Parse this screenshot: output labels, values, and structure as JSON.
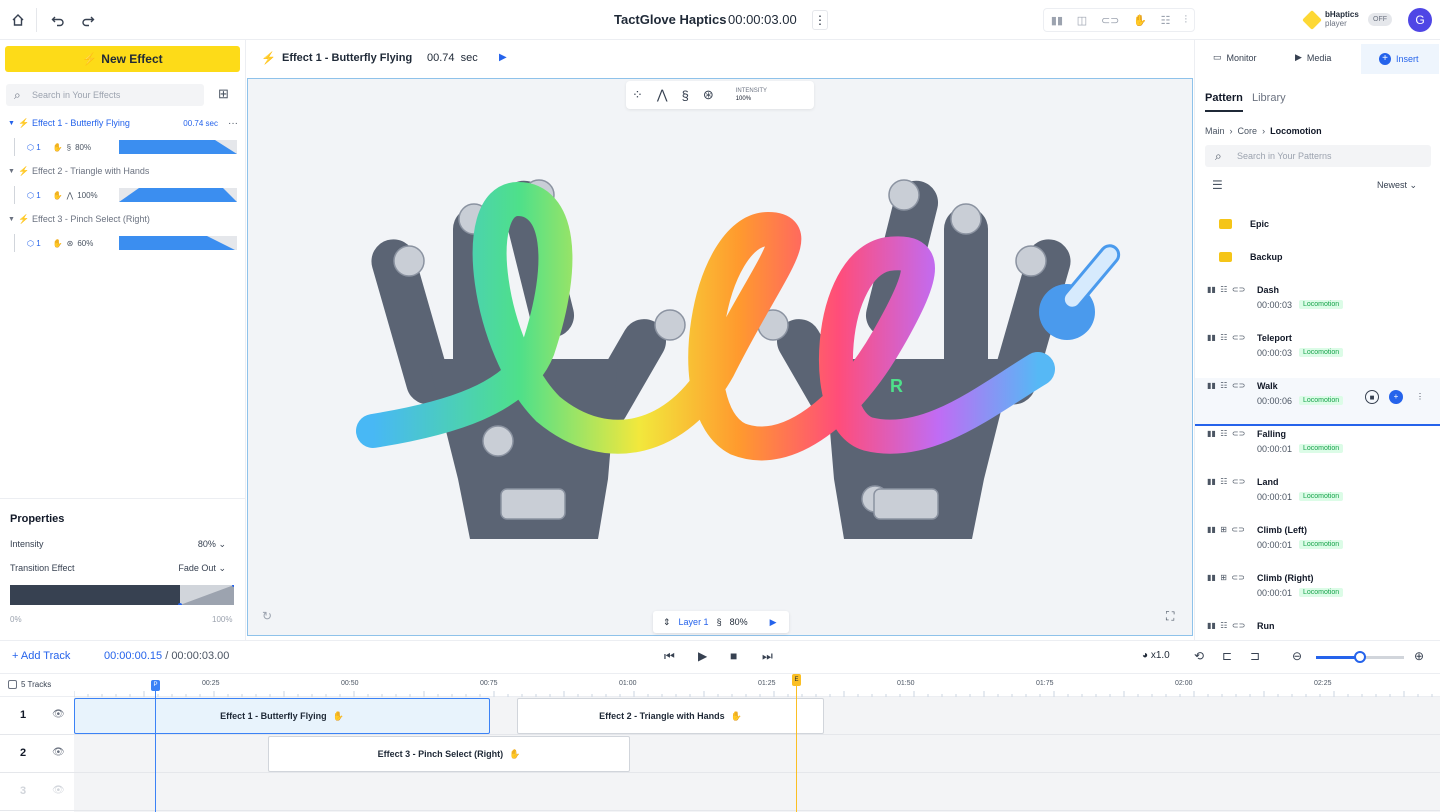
{
  "app": {
    "title": "TactGlove Haptics",
    "time": "00:00:03.00",
    "kebab": "⋮"
  },
  "toolbar_icons": [
    "glove-icon",
    "camera-icon",
    "link-icon",
    "hand-icon",
    "grid-icon",
    "layers-icon"
  ],
  "bhaptics": {
    "name": "bHaptics",
    "sub": "player",
    "toggle": "OFF"
  },
  "user": {
    "initial": "G"
  },
  "left": {
    "new_effect": "New Effect",
    "search_placeholder": "Search in Your Effects",
    "effects": [
      {
        "name": "Effect 1 - Butterfly Flying",
        "duration": "00.74 sec",
        "layer": "1",
        "intensity": "80%"
      },
      {
        "name": "Effect 2 - Triangle with Hands",
        "layer": "1",
        "intensity": "100%"
      },
      {
        "name": "Effect 3 - Pinch Select (Right)",
        "layer": "1",
        "intensity": "60%"
      }
    ],
    "more": "···",
    "properties": {
      "title": "Properties",
      "intensity_label": "Intensity",
      "intensity_value": "80%",
      "transition_label": "Transition Effect",
      "transition_value": "Fade Out",
      "min": "0%",
      "max": "100%"
    }
  },
  "center": {
    "effect_name": "Effect 1 - Butterfly Flying",
    "duration": "00.74",
    "unit": "sec",
    "intensity_label": "INTENSITY",
    "intensity_value": "100%",
    "hand_label": "R",
    "layer": {
      "name": "Layer 1",
      "intensity": "80%"
    }
  },
  "right": {
    "tabs": {
      "monitor": "Monitor",
      "media": "Media",
      "insert": "Insert"
    },
    "subtabs": {
      "pattern": "Pattern",
      "library": "Library"
    },
    "breadcrumb": {
      "a": "Main",
      "b": "Core",
      "c": "Locomotion"
    },
    "search_placeholder": "Search in Your Patterns",
    "sort": "Newest",
    "folders": [
      "Epic",
      "Backup"
    ],
    "patterns": [
      {
        "name": "Dash",
        "time": "00:00:03",
        "tag": "Locomotion"
      },
      {
        "name": "Teleport",
        "time": "00:00:03",
        "tag": "Locomotion"
      },
      {
        "name": "Walk",
        "time": "00:00:06",
        "tag": "Locomotion"
      },
      {
        "name": "Falling",
        "time": "00:00:01",
        "tag": "Locomotion"
      },
      {
        "name": "Land",
        "time": "00:00:01",
        "tag": "Locomotion"
      },
      {
        "name": "Climb (Left)",
        "time": "00:00:01",
        "tag": "Locomotion"
      },
      {
        "name": "Climb (Right)",
        "time": "00:00:01",
        "tag": "Locomotion"
      },
      {
        "name": "Run",
        "time": "",
        "tag": ""
      }
    ]
  },
  "timeline": {
    "add_track": "Add Track",
    "current": "00:00:00.15",
    "separator": "/",
    "total": "00:00:03.00",
    "speed": "x1.0",
    "tracks_label": "5 Tracks",
    "ticks": [
      "00:25",
      "00:50",
      "00:75",
      "01:00",
      "01:25",
      "01:50",
      "01:75",
      "02:00",
      "02:25"
    ],
    "rows": [
      "1",
      "2",
      "3"
    ],
    "clips": {
      "c1": "Effect 1 - Butterfly Flying",
      "c2": "Effect 2 - Triangle with Hands",
      "c3": "Effect 3 - Pinch Select (Right)"
    },
    "playhead_label": "P",
    "end_label": "E"
  },
  "colors": {
    "accent": "#2563eb",
    "brand_yellow": "#fddb18",
    "tag_green": "#16a34a"
  }
}
